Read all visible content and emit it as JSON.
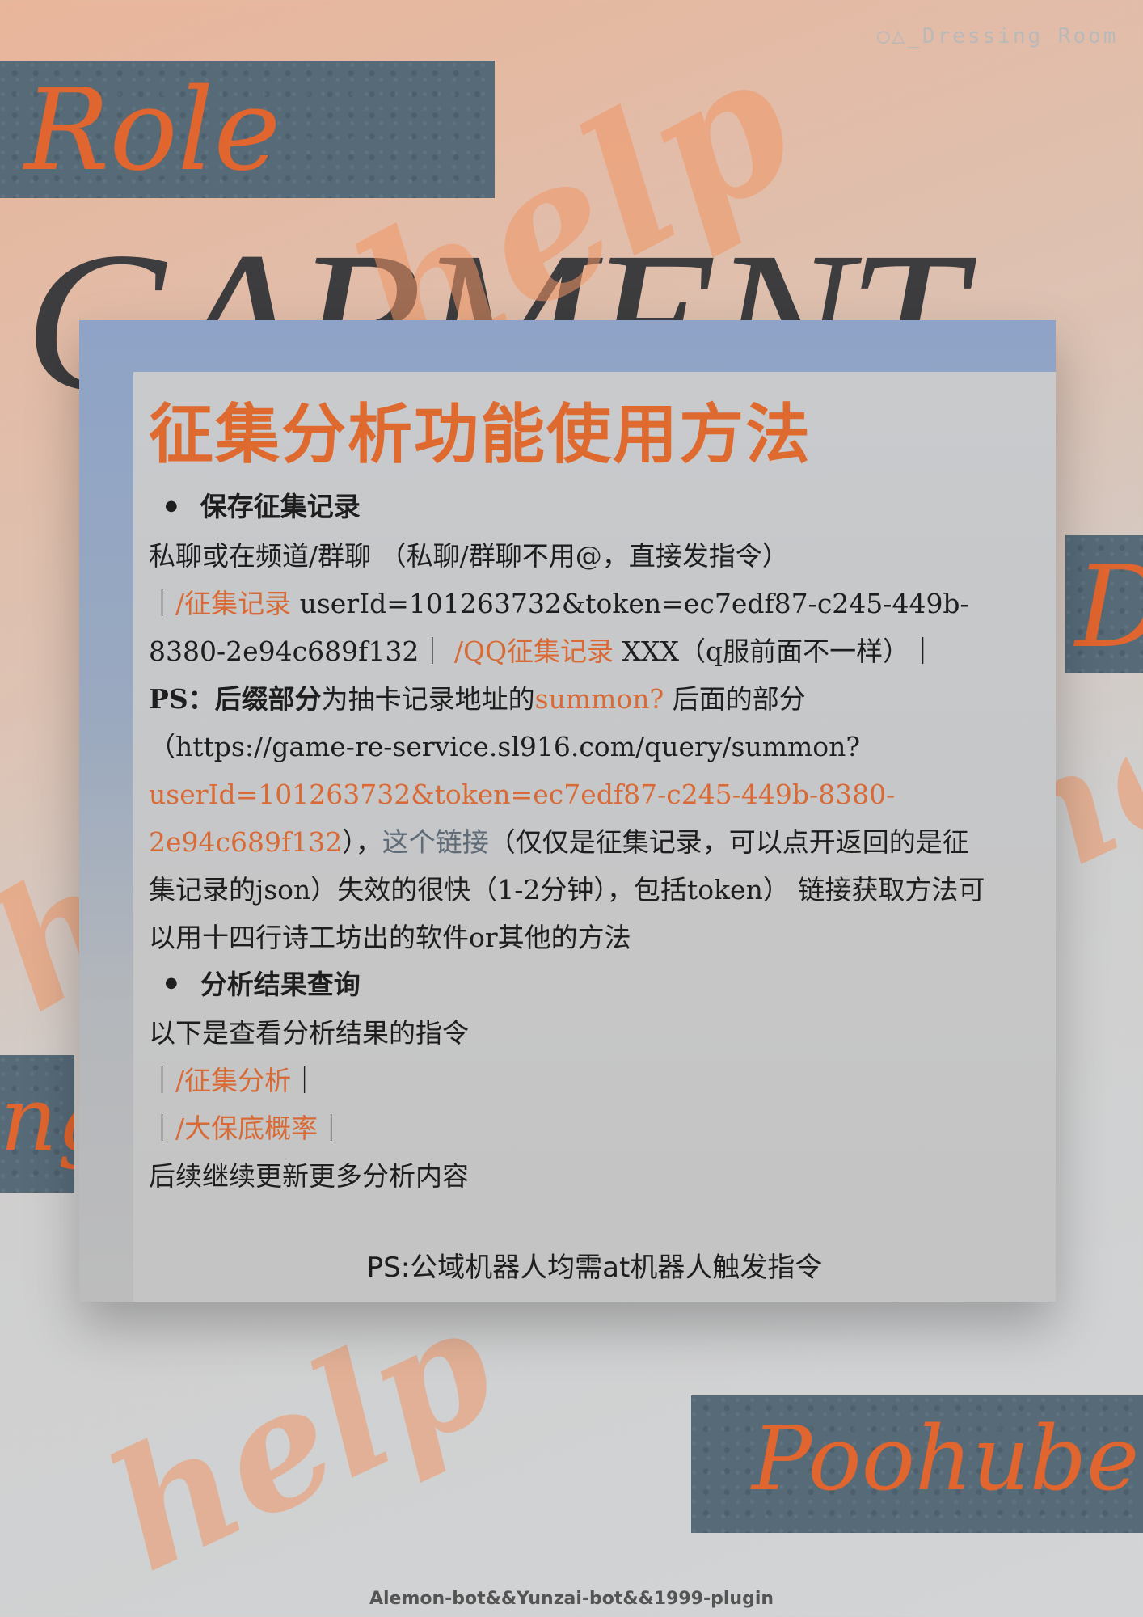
{
  "decor": {
    "brand_tag": "○△_Dressing Room",
    "background_word": "GARMENT",
    "script_top": "Role",
    "script_bottom": "Poohube",
    "script_side_right": "D",
    "script_side_left": "ng",
    "watermark": "help"
  },
  "panel": {
    "title": "征集分析功能使用方法",
    "section1": {
      "heading": "保存征集记录",
      "line1": "私聊或在频道/群聊 （私聊/群聊不用@，直接发指令）",
      "sep": "｜",
      "cmd1": "/征集记录",
      "cmd1_arg": " userId=101263732&token=ec7edf87-c245-449b-8380-2e94c689f132",
      "cmd2": "/QQ征集记录",
      "cmd2_arg": " XXX（q服前面不一样）",
      "ps_label": "PS：后缀部分",
      "ps_text1": "为抽卡记录地址的",
      "ps_summon": "summon?",
      "ps_text2": " 后面的部分",
      "url_part": "（https://game-re-service.sl916.com/query/summon?",
      "url_query": "userId=101263732&token=ec7edf87-c245-449b-8380-2e94c689f132",
      "url_close": "），",
      "link_text": "这个链接",
      "tail": "（仅仅是征集记录，可以点开返回的是征集记录的json）失效的很快（1-2分钟），包括token） 链接获取方法可以用十四行诗工坊出的软件or其他的方法"
    },
    "section2": {
      "heading": "分析结果查询",
      "intro": "以下是查看分析结果的指令",
      "cmd1": "/征集分析",
      "cmd2": "/大保底概率",
      "more": "后续继续更新更多分析内容"
    },
    "ps_note": "PS:公域机器人均需at机器人触发指令"
  },
  "footer": "Alemon-bot&&Yunzai-bot&&1999-plugin",
  "colors": {
    "accent": "#df6a30",
    "link": "#5f6c78",
    "block": "#566a78"
  }
}
